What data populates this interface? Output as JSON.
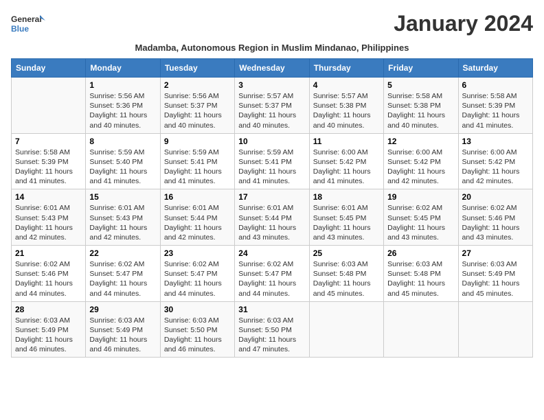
{
  "logo": {
    "general": "General",
    "blue": "Blue"
  },
  "title": "January 2024",
  "subtitle": "Madamba, Autonomous Region in Muslim Mindanao, Philippines",
  "days": [
    "Sunday",
    "Monday",
    "Tuesday",
    "Wednesday",
    "Thursday",
    "Friday",
    "Saturday"
  ],
  "weeks": [
    [
      {
        "day": "",
        "content": ""
      },
      {
        "day": "1",
        "content": "Sunrise: 5:56 AM\nSunset: 5:36 PM\nDaylight: 11 hours\nand 40 minutes."
      },
      {
        "day": "2",
        "content": "Sunrise: 5:56 AM\nSunset: 5:37 PM\nDaylight: 11 hours\nand 40 minutes."
      },
      {
        "day": "3",
        "content": "Sunrise: 5:57 AM\nSunset: 5:37 PM\nDaylight: 11 hours\nand 40 minutes."
      },
      {
        "day": "4",
        "content": "Sunrise: 5:57 AM\nSunset: 5:38 PM\nDaylight: 11 hours\nand 40 minutes."
      },
      {
        "day": "5",
        "content": "Sunrise: 5:58 AM\nSunset: 5:38 PM\nDaylight: 11 hours\nand 40 minutes."
      },
      {
        "day": "6",
        "content": "Sunrise: 5:58 AM\nSunset: 5:39 PM\nDaylight: 11 hours\nand 41 minutes."
      }
    ],
    [
      {
        "day": "7",
        "content": "Sunrise: 5:58 AM\nSunset: 5:39 PM\nDaylight: 11 hours\nand 41 minutes."
      },
      {
        "day": "8",
        "content": "Sunrise: 5:59 AM\nSunset: 5:40 PM\nDaylight: 11 hours\nand 41 minutes."
      },
      {
        "day": "9",
        "content": "Sunrise: 5:59 AM\nSunset: 5:41 PM\nDaylight: 11 hours\nand 41 minutes."
      },
      {
        "day": "10",
        "content": "Sunrise: 5:59 AM\nSunset: 5:41 PM\nDaylight: 11 hours\nand 41 minutes."
      },
      {
        "day": "11",
        "content": "Sunrise: 6:00 AM\nSunset: 5:42 PM\nDaylight: 11 hours\nand 41 minutes."
      },
      {
        "day": "12",
        "content": "Sunrise: 6:00 AM\nSunset: 5:42 PM\nDaylight: 11 hours\nand 42 minutes."
      },
      {
        "day": "13",
        "content": "Sunrise: 6:00 AM\nSunset: 5:42 PM\nDaylight: 11 hours\nand 42 minutes."
      }
    ],
    [
      {
        "day": "14",
        "content": "Sunrise: 6:01 AM\nSunset: 5:43 PM\nDaylight: 11 hours\nand 42 minutes."
      },
      {
        "day": "15",
        "content": "Sunrise: 6:01 AM\nSunset: 5:43 PM\nDaylight: 11 hours\nand 42 minutes."
      },
      {
        "day": "16",
        "content": "Sunrise: 6:01 AM\nSunset: 5:44 PM\nDaylight: 11 hours\nand 42 minutes."
      },
      {
        "day": "17",
        "content": "Sunrise: 6:01 AM\nSunset: 5:44 PM\nDaylight: 11 hours\nand 43 minutes."
      },
      {
        "day": "18",
        "content": "Sunrise: 6:01 AM\nSunset: 5:45 PM\nDaylight: 11 hours\nand 43 minutes."
      },
      {
        "day": "19",
        "content": "Sunrise: 6:02 AM\nSunset: 5:45 PM\nDaylight: 11 hours\nand 43 minutes."
      },
      {
        "day": "20",
        "content": "Sunrise: 6:02 AM\nSunset: 5:46 PM\nDaylight: 11 hours\nand 43 minutes."
      }
    ],
    [
      {
        "day": "21",
        "content": "Sunrise: 6:02 AM\nSunset: 5:46 PM\nDaylight: 11 hours\nand 44 minutes."
      },
      {
        "day": "22",
        "content": "Sunrise: 6:02 AM\nSunset: 5:47 PM\nDaylight: 11 hours\nand 44 minutes."
      },
      {
        "day": "23",
        "content": "Sunrise: 6:02 AM\nSunset: 5:47 PM\nDaylight: 11 hours\nand 44 minutes."
      },
      {
        "day": "24",
        "content": "Sunrise: 6:02 AM\nSunset: 5:47 PM\nDaylight: 11 hours\nand 44 minutes."
      },
      {
        "day": "25",
        "content": "Sunrise: 6:03 AM\nSunset: 5:48 PM\nDaylight: 11 hours\nand 45 minutes."
      },
      {
        "day": "26",
        "content": "Sunrise: 6:03 AM\nSunset: 5:48 PM\nDaylight: 11 hours\nand 45 minutes."
      },
      {
        "day": "27",
        "content": "Sunrise: 6:03 AM\nSunset: 5:49 PM\nDaylight: 11 hours\nand 45 minutes."
      }
    ],
    [
      {
        "day": "28",
        "content": "Sunrise: 6:03 AM\nSunset: 5:49 PM\nDaylight: 11 hours\nand 46 minutes."
      },
      {
        "day": "29",
        "content": "Sunrise: 6:03 AM\nSunset: 5:49 PM\nDaylight: 11 hours\nand 46 minutes."
      },
      {
        "day": "30",
        "content": "Sunrise: 6:03 AM\nSunset: 5:50 PM\nDaylight: 11 hours\nand 46 minutes."
      },
      {
        "day": "31",
        "content": "Sunrise: 6:03 AM\nSunset: 5:50 PM\nDaylight: 11 hours\nand 47 minutes."
      },
      {
        "day": "",
        "content": ""
      },
      {
        "day": "",
        "content": ""
      },
      {
        "day": "",
        "content": ""
      }
    ]
  ]
}
